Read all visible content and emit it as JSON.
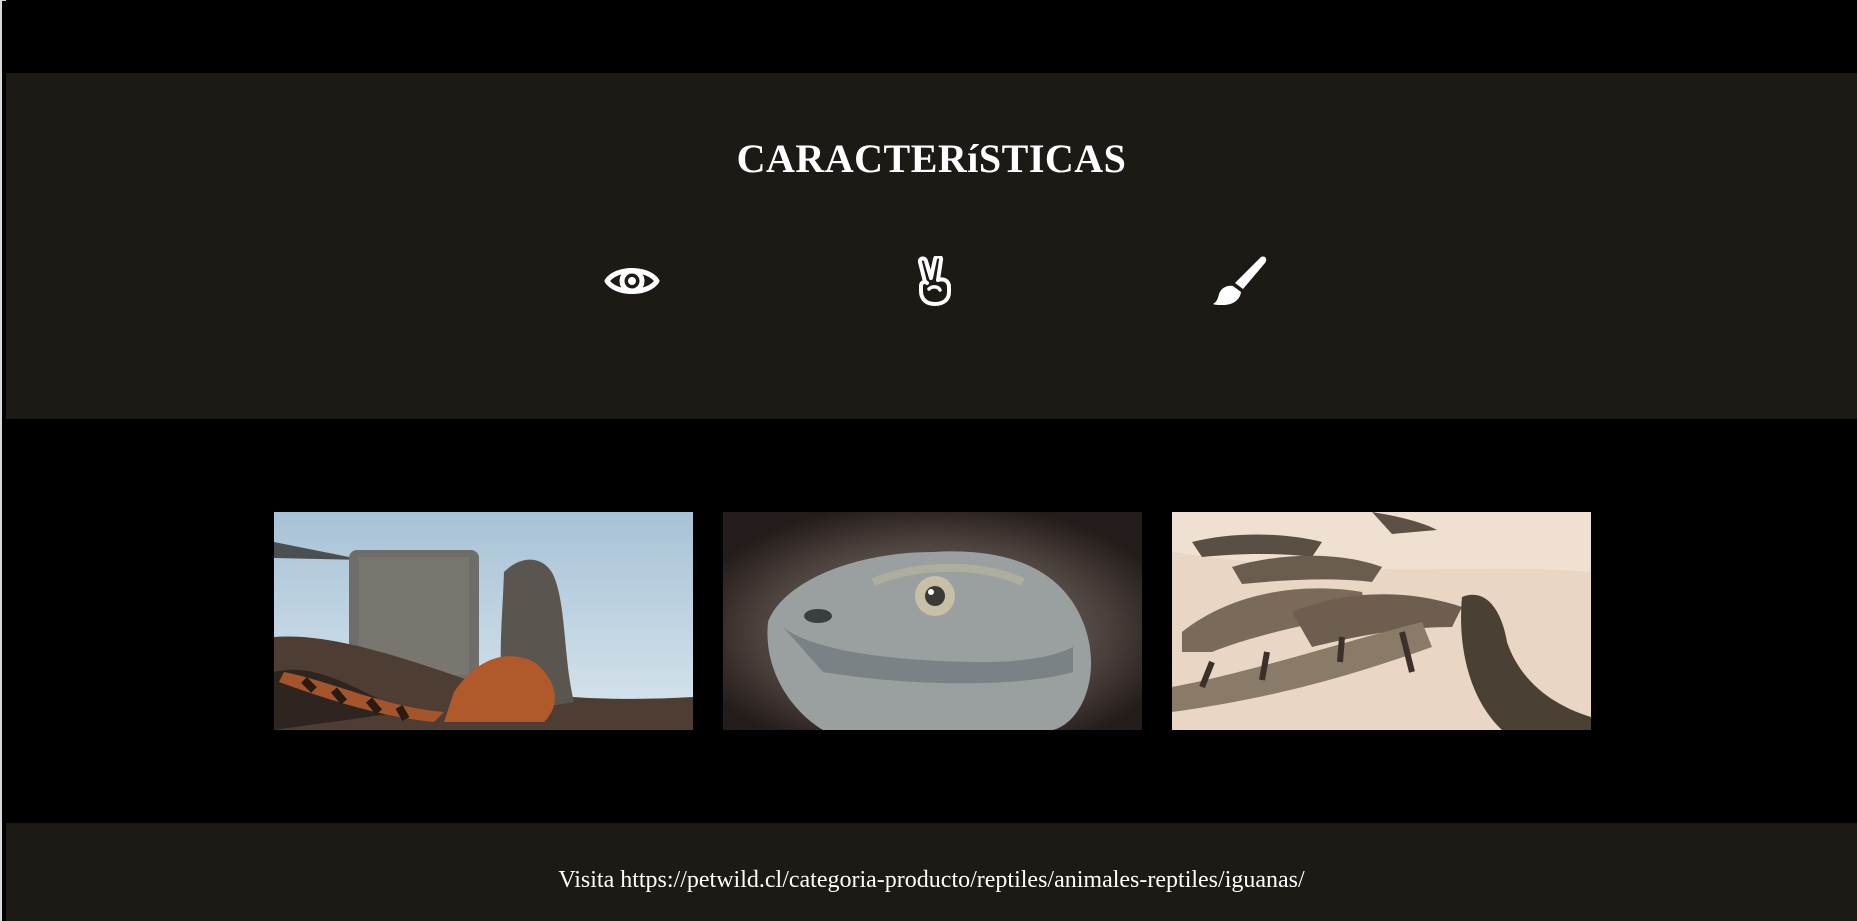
{
  "features": {
    "title": "CARACTERíSTICAS",
    "icons": [
      "eye-icon",
      "peace-hand-icon",
      "paintbrush-icon"
    ]
  },
  "gallery": {
    "images": [
      "iguana-on-rock-by-sea",
      "iguana-head-closeup",
      "iguanas-group-on-sand"
    ]
  },
  "footer": {
    "text": "Visita https://petwild.cl/categoria-producto/reptiles/animales-reptiles/iguanas/"
  },
  "colors": {
    "section_bg": "#1d1915",
    "page_bg": "#000000",
    "text": "#ffffff"
  }
}
